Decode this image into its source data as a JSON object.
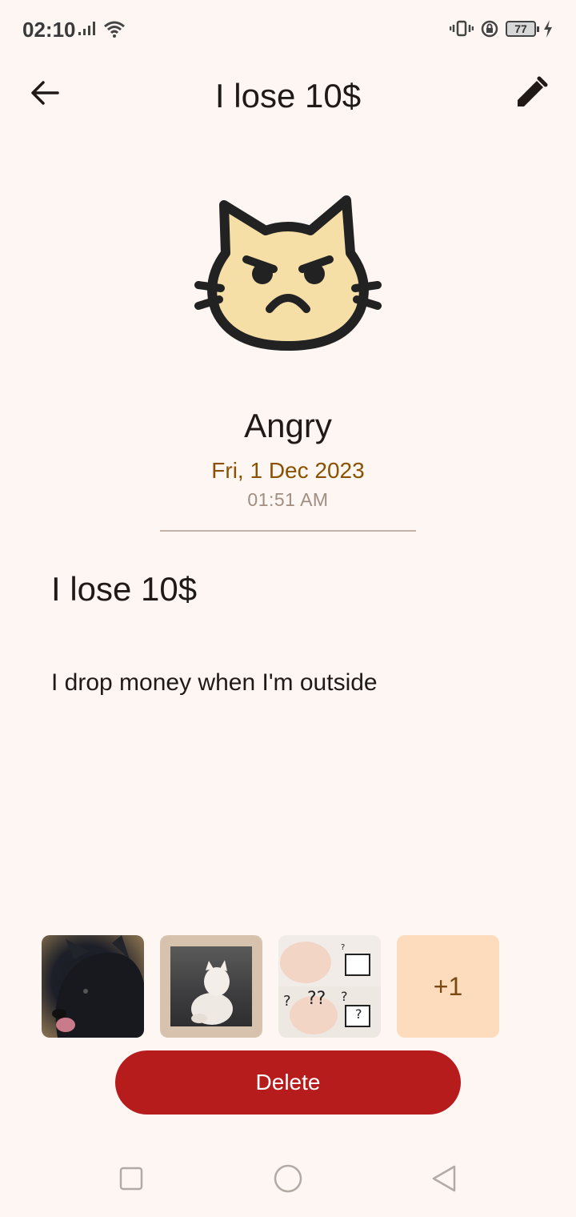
{
  "status_bar": {
    "time": "02:10",
    "battery": "77",
    "icons": [
      "signal-icon",
      "wifi-icon",
      "vibrate-icon",
      "rotation-lock-icon",
      "battery-icon",
      "charging-icon"
    ]
  },
  "header": {
    "title": "I lose 10$",
    "back_icon": "arrow-left-icon",
    "edit_icon": "pencil-icon"
  },
  "mood": {
    "icon": "angry-cat-face-icon",
    "label": "Angry",
    "date": "Fri, 1 Dec 2023",
    "time": "01:51 AM"
  },
  "entry": {
    "title": "I lose 10$",
    "body": "I drop money when I'm outside"
  },
  "attachments": {
    "items": [
      "dog-photo",
      "cat-photo",
      "cat-meme-photo"
    ],
    "more_label": "+1"
  },
  "actions": {
    "delete_label": "Delete"
  },
  "colors": {
    "background": "#fdf6f3",
    "accent_date": "#8a5200",
    "delete": "#b71c1c",
    "more_tile": "#fddcbe",
    "face_fill": "#f5dfa6"
  },
  "nav_bar": {
    "icons": [
      "recents-square-icon",
      "home-circle-icon",
      "back-triangle-icon"
    ]
  }
}
